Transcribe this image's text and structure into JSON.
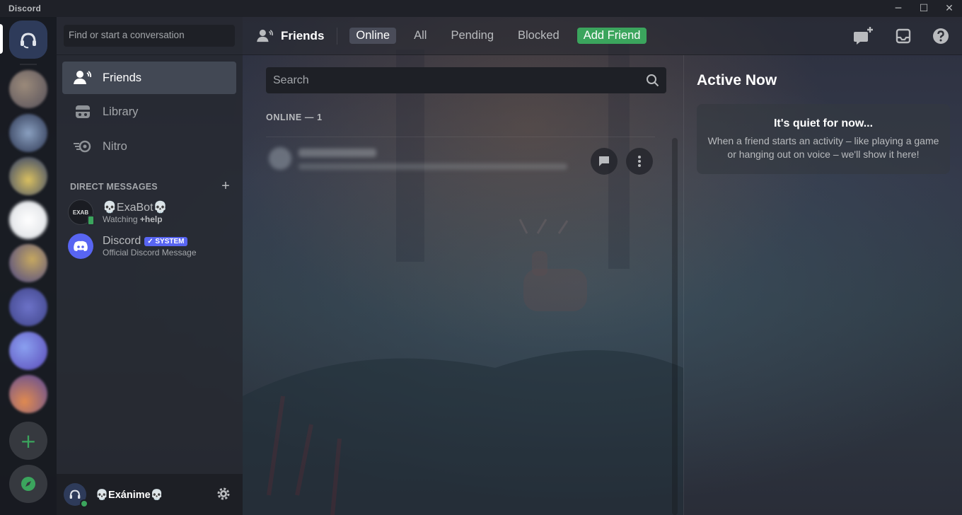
{
  "titlebar": {
    "app_name": "Discord",
    "controls": [
      "─",
      "☐",
      "✕"
    ]
  },
  "rail": {
    "home_icon": "discord-headset-icon",
    "add_server_label": "+",
    "explore_icon": "compass-icon"
  },
  "sidebar": {
    "search_placeholder": "Find or start a conversation",
    "nav": [
      {
        "label": "Friends",
        "icon": "friends-wave-icon",
        "active": true
      },
      {
        "label": "Library",
        "icon": "library-icon",
        "active": false
      },
      {
        "label": "Nitro",
        "icon": "nitro-icon",
        "active": false
      }
    ],
    "dm_header": "DIRECT MESSAGES",
    "dm_add": "+",
    "dms": [
      {
        "name": "💀ExaBot💀",
        "sub_prefix": "Watching ",
        "sub_bold": "+help",
        "avatar_text": "EXAB"
      },
      {
        "name": "Discord",
        "badge": "✓ SYSTEM",
        "sub_prefix": "Official Discord Message",
        "sub_bold": ""
      }
    ]
  },
  "user_panel": {
    "username": "💀Exánime💀",
    "status_color": "#3ba55d"
  },
  "topbar": {
    "title": "Friends",
    "tabs": [
      {
        "label": "Online",
        "active": true
      },
      {
        "label": "All",
        "active": false
      },
      {
        "label": "Pending",
        "active": false
      },
      {
        "label": "Blocked",
        "active": false
      }
    ],
    "add_friend": "Add Friend",
    "icons": [
      "new-group-dm-icon",
      "inbox-icon",
      "help-icon"
    ]
  },
  "friends": {
    "search_placeholder": "Search",
    "online_header": "ONLINE — 1"
  },
  "active_now": {
    "title": "Active Now",
    "card_heading": "It's quiet for now...",
    "card_text": "When a friend starts an activity – like playing a game or hanging out on voice – we'll show it here!"
  },
  "colors": {
    "brand": "#5865f2",
    "green": "#3ba55d"
  }
}
